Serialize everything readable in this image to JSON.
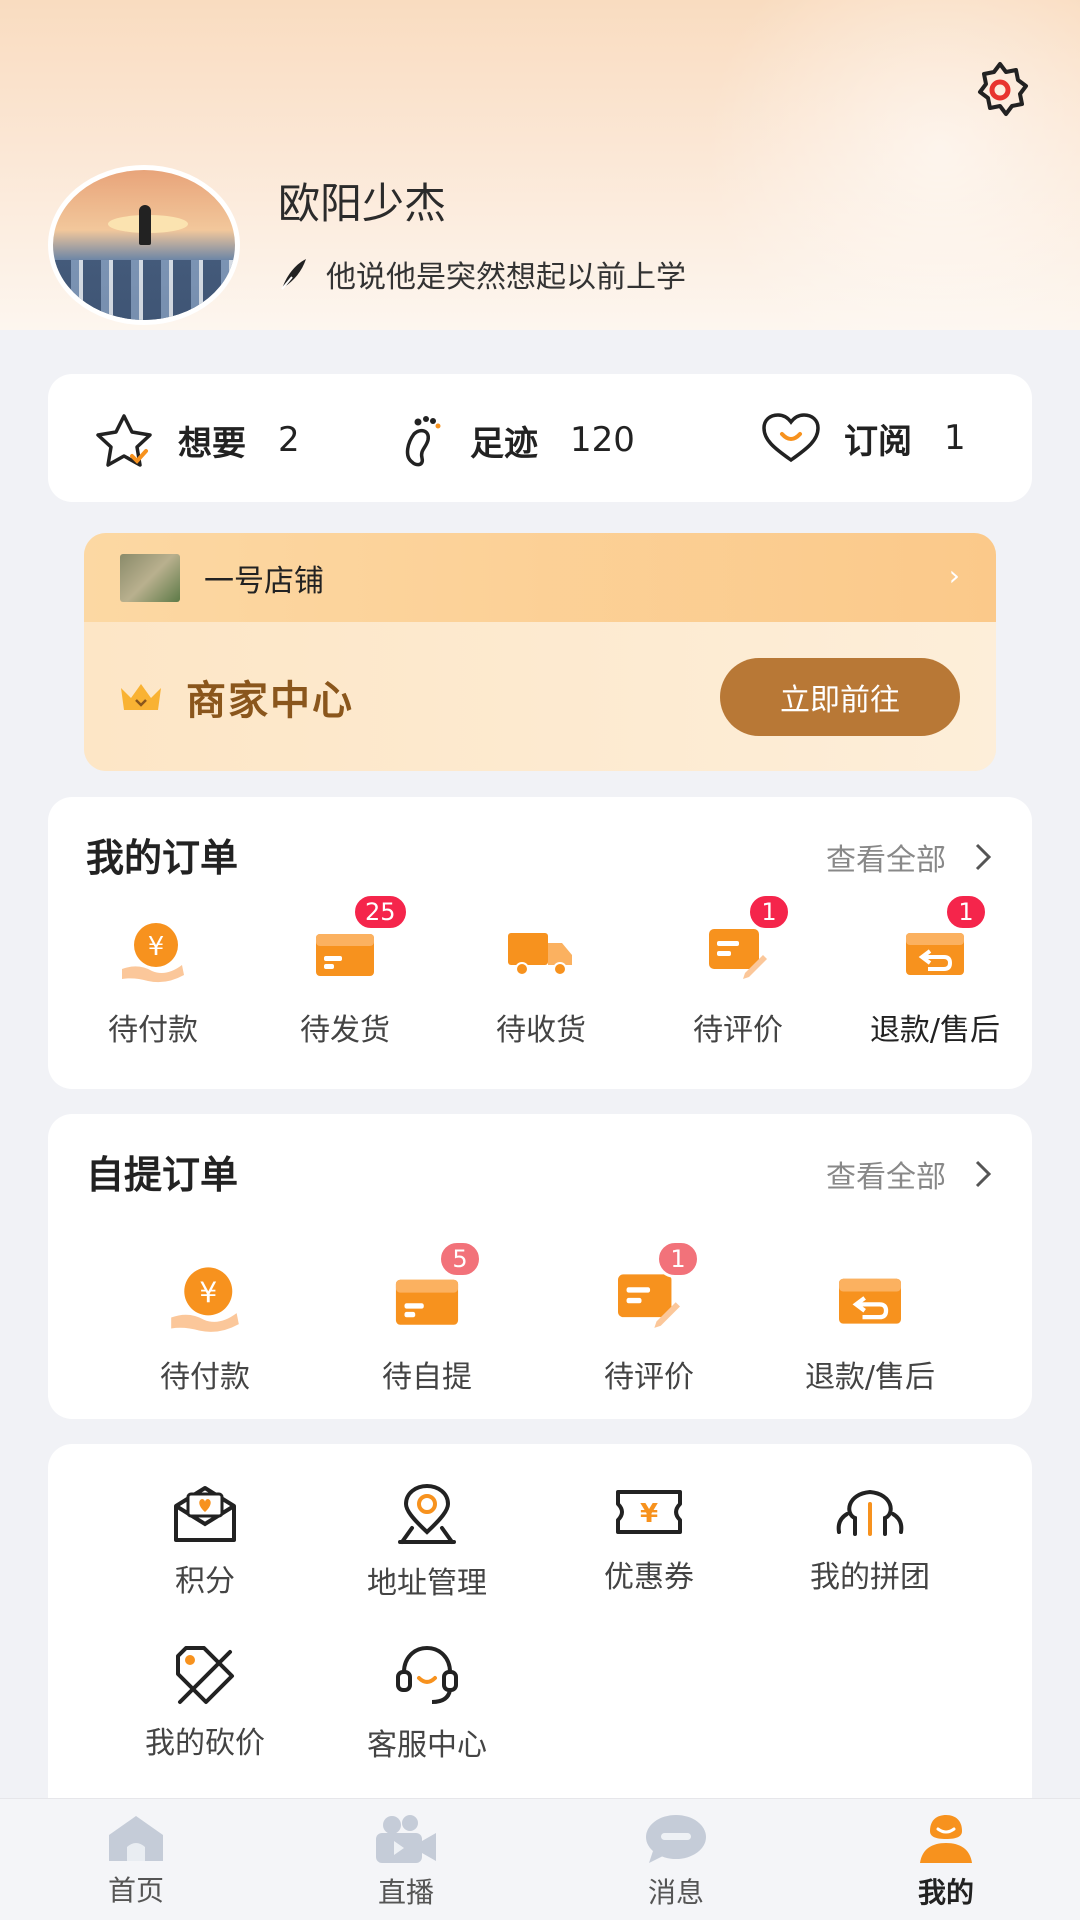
{
  "profile": {
    "name": "欧阳少杰",
    "signature": "他说他是突然想起以前上学"
  },
  "stats": [
    {
      "label": "想要",
      "value": "2",
      "icon": "star-icon"
    },
    {
      "label": "足迹",
      "value": "120",
      "icon": "footprint-icon"
    },
    {
      "label": "订阅",
      "value": "1",
      "icon": "heart-icon"
    }
  ],
  "shop": {
    "name": "一号店铺",
    "merchant_center": "商家中心",
    "go_label": "立即前往"
  },
  "orders": {
    "title": "我的订单",
    "view_all": "查看全部",
    "items": [
      {
        "label": "待付款",
        "icon": "payment-icon",
        "badge": ""
      },
      {
        "label": "待发货",
        "icon": "to-ship-icon",
        "badge": "25"
      },
      {
        "label": "待收货",
        "icon": "truck-icon",
        "badge": ""
      },
      {
        "label": "待评价",
        "icon": "review-icon",
        "badge": "1"
      },
      {
        "label": "退款/售后",
        "icon": "refund-icon",
        "badge": "1"
      }
    ]
  },
  "pickup": {
    "title": "自提订单",
    "view_all": "查看全部",
    "items": [
      {
        "label": "待付款",
        "icon": "payment-icon",
        "badge": ""
      },
      {
        "label": "待自提",
        "icon": "pickup-icon",
        "badge": "5"
      },
      {
        "label": "待评价",
        "icon": "review-icon",
        "badge": "1"
      },
      {
        "label": "退款/售后",
        "icon": "refund-icon",
        "badge": ""
      }
    ]
  },
  "tools": [
    {
      "label": "积分",
      "icon": "points-icon"
    },
    {
      "label": "地址管理",
      "icon": "location-icon"
    },
    {
      "label": "优惠券",
      "icon": "coupon-icon"
    },
    {
      "label": "我的拼团",
      "icon": "group-icon"
    },
    {
      "label": "我的砍价",
      "icon": "bargain-icon"
    },
    {
      "label": "客服中心",
      "icon": "headset-icon"
    }
  ],
  "tabbar": [
    {
      "label": "首页",
      "icon": "home-icon"
    },
    {
      "label": "直播",
      "icon": "live-icon"
    },
    {
      "label": "消息",
      "icon": "message-icon"
    },
    {
      "label": "我的",
      "icon": "profile-icon"
    }
  ],
  "colors": {
    "accent": "#f7921e",
    "badge": "#f5254b",
    "merchant_button": "#b87836",
    "merchant_text": "#8a561c"
  }
}
